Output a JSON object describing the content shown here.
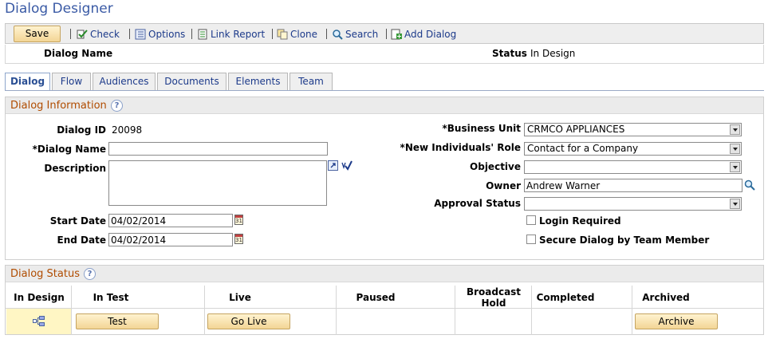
{
  "page": {
    "title": "Dialog Designer"
  },
  "toolbar": {
    "save_label": "Save",
    "items": [
      {
        "label": "Check",
        "icon": "check-icon"
      },
      {
        "label": "Options",
        "icon": "options-icon"
      },
      {
        "label": "Link Report",
        "icon": "link-report-icon"
      },
      {
        "label": "Clone",
        "icon": "clone-icon"
      },
      {
        "label": "Search",
        "icon": "search-icon"
      },
      {
        "label": "Add Dialog",
        "icon": "add-dialog-icon"
      }
    ]
  },
  "header": {
    "dialog_name_label": "Dialog Name",
    "status_label": "Status",
    "status_value": "In Design"
  },
  "tabs": [
    {
      "label": "Dialog",
      "active": true
    },
    {
      "label": "Flow"
    },
    {
      "label": "Audiences"
    },
    {
      "label": "Documents"
    },
    {
      "label": "Elements"
    },
    {
      "label": "Team"
    }
  ],
  "dialog_info": {
    "title": "Dialog Information",
    "dialog_id_label": "Dialog ID",
    "dialog_id_value": "20098",
    "dialog_name_label": "*Dialog Name",
    "dialog_name_value": "",
    "description_label": "Description",
    "start_date_label": "Start Date",
    "start_date_value": "04/02/2014",
    "end_date_label": "End Date",
    "end_date_value": "04/02/2014",
    "business_unit_label": "*Business Unit",
    "business_unit_value": "CRMCO APPLIANCES",
    "role_label": "*New Individuals' Role",
    "role_value": "Contact for a Company",
    "objective_label": "Objective",
    "objective_value": "",
    "owner_label": "Owner",
    "owner_value": "Andrew Warner",
    "approval_label": "Approval Status",
    "approval_value": "",
    "login_required_label": "Login Required",
    "secure_dialog_label": "Secure Dialog by Team Member"
  },
  "dialog_status": {
    "title": "Dialog Status",
    "columns": [
      "In Design",
      "In Test",
      "Live",
      "Paused",
      "Broadcast Hold",
      "Completed",
      "Archived"
    ],
    "test_button": "Test",
    "golive_button": "Go Live",
    "archive_button": "Archive",
    "current_icon": "current-status-icon"
  },
  "help_glyph": "?",
  "colors": {
    "title_blue": "#3a5aa5",
    "link_blue": "#1c3a8a",
    "group_title": "#b04c00",
    "button_gold": "#f3d595",
    "current_status_bg": "#fff6c4"
  }
}
